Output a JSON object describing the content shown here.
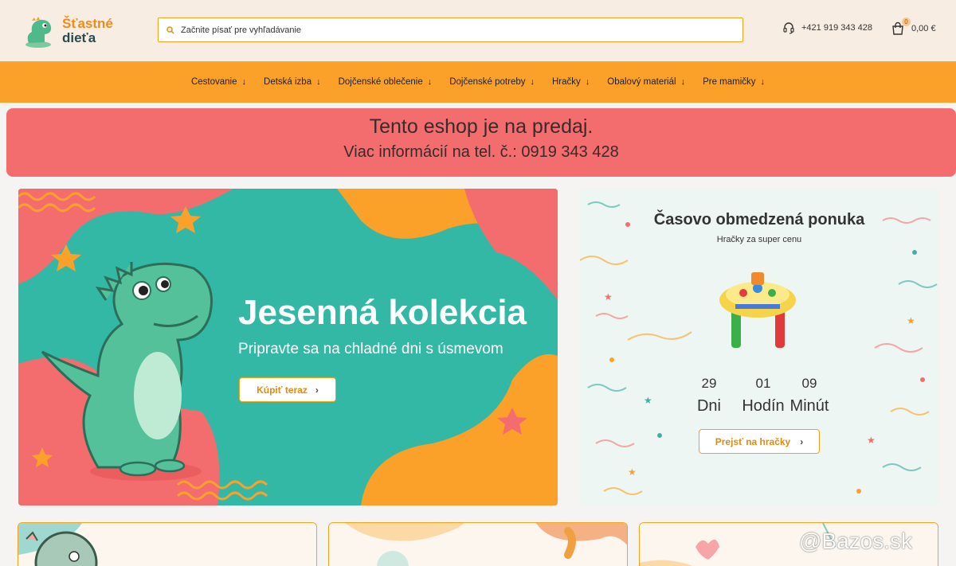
{
  "header": {
    "logo_line1": "Šťastné",
    "logo_line2": "dieťa",
    "search_placeholder": "Začnite písať pre vyhľadávanie",
    "phone": "+421 919 343 428",
    "cart_count": "0",
    "cart_total": "0,00 €"
  },
  "nav": {
    "items": [
      {
        "label": "Cestovanie"
      },
      {
        "label": "Detská izba"
      },
      {
        "label": "Dojčenské oblečenie"
      },
      {
        "label": "Dojčenské potreby"
      },
      {
        "label": "Hračky"
      },
      {
        "label": "Obalový materiál"
      },
      {
        "label": "Pre mamičky"
      }
    ],
    "arrow": "↓"
  },
  "sale_banner": {
    "title": "Tento eshop je na predaj.",
    "subtitle": "Viac informácií na tel. č.: 0919 343 428"
  },
  "hero": {
    "title": "Jesenná kolekcia",
    "subtitle": "Pripravte sa na chladné dni s úsmevom",
    "button_label": "Kúpiť teraz"
  },
  "offer": {
    "title": "Časovo obmedzená ponuka",
    "subtitle": "Hračky za super cenu",
    "countdown": [
      {
        "value": "29",
        "label": "Dni"
      },
      {
        "value": "01",
        "label": "Hodín"
      },
      {
        "value": "09",
        "label": "Minút"
      }
    ],
    "button_label": "Prejsť na hračky"
  },
  "watermark": "@Bazos.sk",
  "colors": {
    "accent_orange": "#fba12a",
    "sale_red": "#f46d6e",
    "teal": "#33b8a6"
  }
}
